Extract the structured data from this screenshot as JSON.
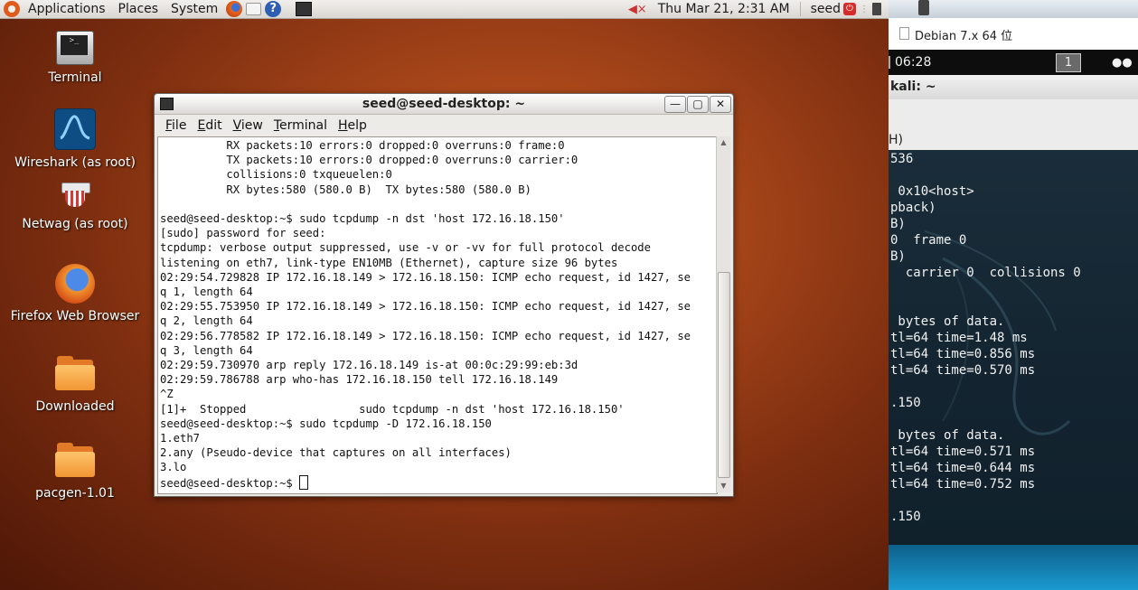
{
  "top_panel": {
    "menus": [
      "Applications",
      "Places",
      "System"
    ],
    "clock": "Thu Mar 21,  2:31 AM",
    "user": "seed"
  },
  "desktop_icons": [
    {
      "label": "Terminal",
      "icon": "terminal-icon"
    },
    {
      "label": "Wireshark (as root)",
      "icon": "wireshark-icon"
    },
    {
      "label": "Netwag (as root)",
      "icon": "netwag-icon"
    },
    {
      "label": "Firefox Web Browser",
      "icon": "firefox-icon"
    },
    {
      "label": "Downloaded",
      "icon": "folder-icon"
    },
    {
      "label": "pacgen-1.01",
      "icon": "folder-icon"
    }
  ],
  "terminal": {
    "title": "seed@seed-desktop: ~",
    "menu": [
      "File",
      "Edit",
      "View",
      "Terminal",
      "Help"
    ],
    "lines": [
      "          RX packets:10 errors:0 dropped:0 overruns:0 frame:0",
      "          TX packets:10 errors:0 dropped:0 overruns:0 carrier:0",
      "          collisions:0 txqueuelen:0",
      "          RX bytes:580 (580.0 B)  TX bytes:580 (580.0 B)",
      "",
      "seed@seed-desktop:~$ sudo tcpdump -n dst 'host 172.16.18.150'",
      "[sudo] password for seed:",
      "tcpdump: verbose output suppressed, use -v or -vv for full protocol decode",
      "listening on eth7, link-type EN10MB (Ethernet), capture size 96 bytes",
      "02:29:54.729828 IP 172.16.18.149 > 172.16.18.150: ICMP echo request, id 1427, se",
      "q 1, length 64",
      "02:29:55.753950 IP 172.16.18.149 > 172.16.18.150: ICMP echo request, id 1427, se",
      "q 2, length 64",
      "02:29:56.778582 IP 172.16.18.149 > 172.16.18.150: ICMP echo request, id 1427, se",
      "q 3, length 64",
      "02:29:59.730970 arp reply 172.16.18.149 is-at 00:0c:29:99:eb:3d",
      "02:29:59.786788 arp who-has 172.16.18.150 tell 172.16.18.149",
      "^Z",
      "[1]+  Stopped                 sudo tcpdump -n dst 'host 172.16.18.150'",
      "seed@seed-desktop:~$ sudo tcpdump -D 172.16.18.150",
      "1.eth7",
      "2.any (Pseudo-device that captures on all interfaces)",
      "3.lo"
    ],
    "prompt": "seed@seed-desktop:~$ "
  },
  "right_vm": {
    "tab_label": "Debian 7.x 64 位",
    "clock": "06:28",
    "workspace": "1",
    "window_title": "kali: ~",
    "menu_fragment": "H)",
    "lines": [
      "536",
      "",
      " 0x10<host>",
      "pback)",
      "B)",
      "0  frame 0",
      "B)",
      "  carrier 0  collisions 0",
      "",
      "",
      " bytes of data.",
      "tl=64 time=1.48 ms",
      "tl=64 time=0.856 ms",
      "tl=64 time=0.570 ms",
      "",
      ".150",
      "",
      " bytes of data.",
      "tl=64 time=0.571 ms",
      "tl=64 time=0.644 ms",
      "tl=64 time=0.752 ms",
      "",
      ".150"
    ]
  }
}
